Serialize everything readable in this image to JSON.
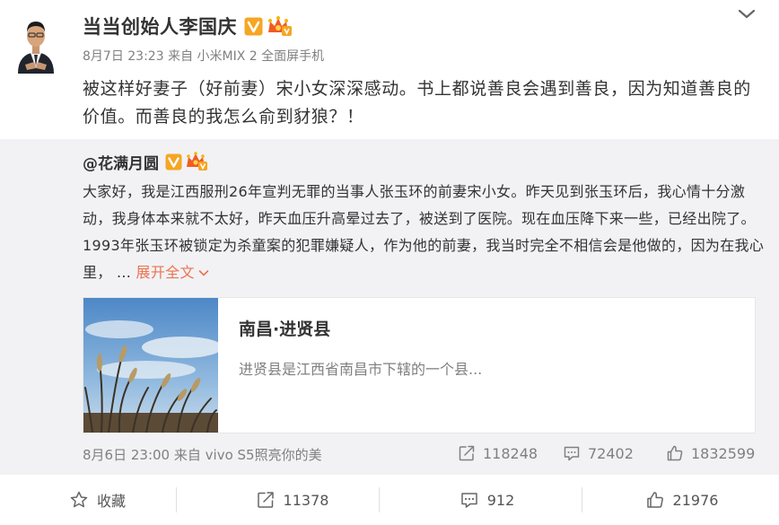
{
  "post": {
    "author_name": "当当创始人李国庆",
    "meta": {
      "date": "8月7日 23:23",
      "from": "来自",
      "device": "小米MIX 2 全面屏手机"
    },
    "text": "被这样好妻子（好前妻）宋小女深深感动。书上都说善良会遇到善良，因为知道善良的价值。而善良的我怎么俞到豺狼？！"
  },
  "repost": {
    "author": "@花满月圆",
    "text": "大家好，我是江西服刑26年宣判无罪的当事人张玉环的前妻宋小女。昨天见到张玉环后，我心情十分激动，我身体本来就不太好，昨天血压升高晕过去了，被送到了医院。现在血压降下来一些，已经出院了。 1993年张玉环被锁定为杀童案的犯罪嫌疑人，作为他的前妻，我当时完全不相信会是他做的，因为在我心里，  ...",
    "expand_label": "展开全文",
    "card": {
      "title": "南昌·进贤县",
      "description": "进贤县是江西省南昌市下辖的一个县..."
    },
    "meta": {
      "date": "8月6日 23:00",
      "from": "来自",
      "device": "vivo S5照亮你的美"
    },
    "stats": {
      "reposts": "118248",
      "comments": "72402",
      "likes": "1832599"
    }
  },
  "actions": {
    "favorite_label": "收藏",
    "repost_count": "11378",
    "comment_count": "912",
    "like_count": "21976"
  },
  "colors": {
    "accent": "#eb7350",
    "verified": "#f5a623",
    "meta_gray": "#808080",
    "repost_bg": "#f2f2f5"
  },
  "icons": [
    "chevron-down-icon",
    "verified-v-icon",
    "crown-badge-icon",
    "expand-arrow-icon",
    "repost-icon",
    "comment-icon",
    "like-icon",
    "star-icon"
  ]
}
